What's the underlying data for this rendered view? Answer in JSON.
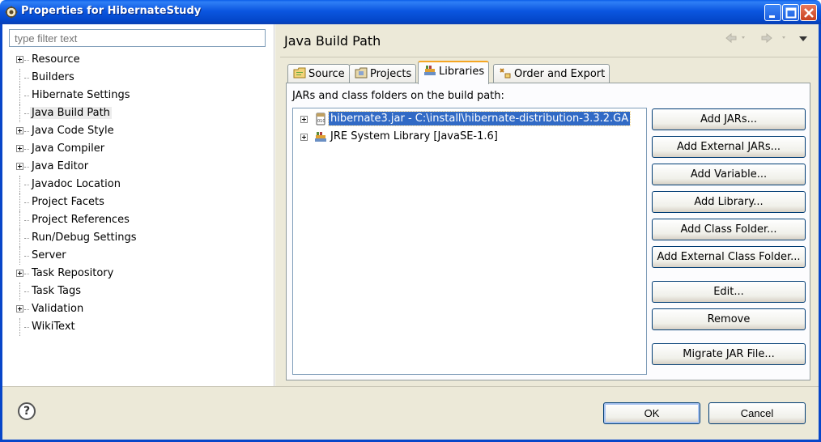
{
  "window": {
    "title": "Properties for HibernateStudy"
  },
  "filter": {
    "placeholder": "type filter text"
  },
  "tree": {
    "items": [
      {
        "label": "Resource",
        "expandable": true
      },
      {
        "label": "Builders",
        "expandable": false
      },
      {
        "label": "Hibernate Settings",
        "expandable": false
      },
      {
        "label": "Java Build Path",
        "expandable": false,
        "selected": true
      },
      {
        "label": "Java Code Style",
        "expandable": true
      },
      {
        "label": "Java Compiler",
        "expandable": true
      },
      {
        "label": "Java Editor",
        "expandable": true
      },
      {
        "label": "Javadoc Location",
        "expandable": false
      },
      {
        "label": "Project Facets",
        "expandable": false
      },
      {
        "label": "Project References",
        "expandable": false
      },
      {
        "label": "Run/Debug Settings",
        "expandable": false
      },
      {
        "label": "Server",
        "expandable": false
      },
      {
        "label": "Task Repository",
        "expandable": true
      },
      {
        "label": "Task Tags",
        "expandable": false
      },
      {
        "label": "Validation",
        "expandable": true
      },
      {
        "label": "WikiText",
        "expandable": false
      }
    ]
  },
  "page": {
    "title": "Java Build Path"
  },
  "tabs": [
    {
      "label": "Source",
      "icon": "source-folder-icon"
    },
    {
      "label": "Projects",
      "icon": "projects-icon"
    },
    {
      "label": "Libraries",
      "icon": "libraries-icon",
      "active": true
    },
    {
      "label": "Order and Export",
      "icon": "order-export-icon"
    }
  ],
  "libraries": {
    "description": "JARs and class folders on the build path:",
    "entries": [
      {
        "label": "hibernate3.jar - C:\\install\\hibernate-distribution-3.3.2.GA",
        "icon": "jar-icon",
        "selected": true
      },
      {
        "label": "JRE System Library [JavaSE-1.6]",
        "icon": "library-icon"
      }
    ]
  },
  "buttons": {
    "add_jars": "Add JARs...",
    "add_external_jars": "Add External JARs...",
    "add_variable": "Add Variable...",
    "add_library": "Add Library...",
    "add_class_folder": "Add Class Folder...",
    "add_external_class_folder": "Add External Class Folder...",
    "edit": "Edit...",
    "remove": "Remove",
    "migrate_jar": "Migrate JAR File..."
  },
  "dialog": {
    "ok": "OK",
    "cancel": "Cancel",
    "help": "?"
  },
  "colors": {
    "titlebar": "#0b56e0",
    "selection": "#316ac5",
    "dialog_bg": "#ece9d8"
  }
}
